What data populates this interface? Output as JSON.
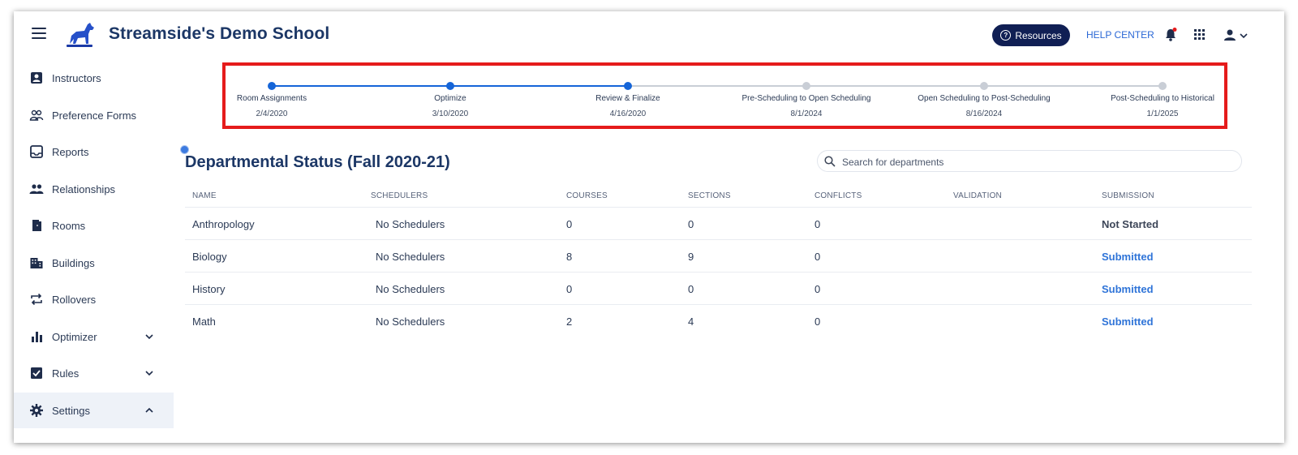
{
  "header": {
    "school_name": "Streamside's Demo School",
    "resources_label": "Resources",
    "help_center_label": "HELP CENTER"
  },
  "sidebar": {
    "items": [
      {
        "label": "Instructors",
        "icon": "person-badge-icon"
      },
      {
        "label": "Preference Forms",
        "icon": "people-outline-icon"
      },
      {
        "label": "Reports",
        "icon": "inbox-icon"
      },
      {
        "label": "Relationships",
        "icon": "group-icon"
      },
      {
        "label": "Rooms",
        "icon": "door-icon"
      },
      {
        "label": "Buildings",
        "icon": "building-icon"
      },
      {
        "label": "Rollovers",
        "icon": "repeat-icon"
      },
      {
        "label": "Optimizer",
        "icon": "bar-chart-icon"
      },
      {
        "label": "Rules",
        "icon": "clipboard-check-icon"
      },
      {
        "label": "Settings",
        "icon": "gear-icon"
      }
    ]
  },
  "stepper": {
    "steps": [
      {
        "label": "Room Assignments",
        "date": "2/4/2020",
        "complete": true
      },
      {
        "label": "Optimize",
        "date": "3/10/2020",
        "complete": true
      },
      {
        "label": "Review & Finalize",
        "date": "4/16/2020",
        "complete": true
      },
      {
        "label": "Pre-Scheduling to Open Scheduling",
        "date": "8/1/2024",
        "complete": false
      },
      {
        "label": "Open Scheduling to Post-Scheduling",
        "date": "8/16/2024",
        "complete": false
      },
      {
        "label": "Post-Scheduling to Historical",
        "date": "1/1/2025",
        "complete": false
      }
    ],
    "colors": {
      "complete": "#1565d8",
      "incomplete": "#c9ced6"
    }
  },
  "main": {
    "title": "Departmental Status (Fall 2020-21)",
    "search_placeholder": "Search for departments",
    "table": {
      "headers": [
        "NAME",
        "SCHEDULERS",
        "COURSES",
        "SECTIONS",
        "CONFLICTS",
        "VALIDATION",
        "SUBMISSION"
      ],
      "rows": [
        {
          "name": "Anthropology",
          "schedulers": "No Schedulers",
          "courses": "0",
          "sections": "0",
          "conflicts": "0",
          "validation": "",
          "submission": "Not Started"
        },
        {
          "name": "Biology",
          "schedulers": "No Schedulers",
          "courses": "8",
          "sections": "9",
          "conflicts": "0",
          "validation": "",
          "submission": "Submitted"
        },
        {
          "name": "History",
          "schedulers": "No Schedulers",
          "courses": "0",
          "sections": "0",
          "conflicts": "0",
          "validation": "",
          "submission": "Submitted"
        },
        {
          "name": "Math",
          "schedulers": "No Schedulers",
          "courses": "2",
          "sections": "4",
          "conflicts": "0",
          "validation": "",
          "submission": "Submitted"
        }
      ]
    }
  },
  "colors": {
    "brand": "#1c3766",
    "link": "#2f74d8",
    "highlight_box": "#e51b1b",
    "notification": "#e51b1b"
  }
}
